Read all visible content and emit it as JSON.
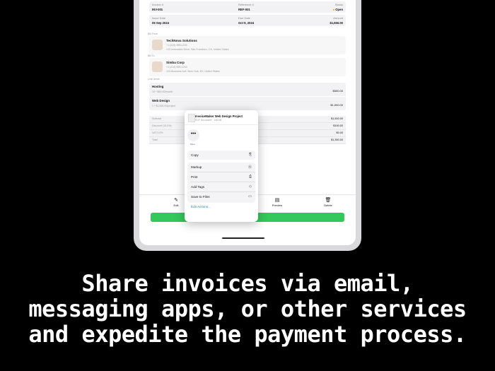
{
  "header": {
    "invoice_label": "Invoice #",
    "invoice_value": "INV-001",
    "reference_label": "Reference #",
    "reference_value": "REF-001",
    "status_label": "Status",
    "status_value": "Open",
    "issue_label": "Issue Date",
    "issue_value": "09 Sep 2024",
    "due_label": "Due Date",
    "due_value": "Oct 9, 2024",
    "amount_label": "Amount",
    "amount_value": "$1,550.00"
  },
  "bill_from": {
    "label": "Bill From",
    "name": "TechNova Solutions",
    "phone": "+1 (415) 555-1234",
    "address": "123 Innovation Drive, San Francisco, CA, United States"
  },
  "bill_to": {
    "label": "Bill To",
    "name": "Simba Corp",
    "phone": "+1 (212) 555-1234",
    "address": "123 Business Ave, New York, NY, United States"
  },
  "line_items": {
    "label": "Line Items",
    "items": [
      {
        "name": "Hosting",
        "detail": "10 * $50.00/month",
        "amount": "$500.00"
      },
      {
        "name": "Web Design",
        "detail": "1 * $1,000.00/project",
        "amount": "$1,000.00"
      }
    ]
  },
  "totals": [
    {
      "label": "Subtotal",
      "value": "$1,500.00"
    },
    {
      "label": "Discount (10.0%)",
      "value": "$150.00"
    },
    {
      "label": "VAT 0.0%",
      "value": "$0.00"
    },
    {
      "label": "Total",
      "value": "$1,350.00"
    }
  ],
  "toolbar": {
    "edit": "Edit",
    "preview": "Preview",
    "delete": "Delete"
  },
  "mark_paid": "Mark as paid",
  "share_sheet": {
    "title": "InvoiceMaker Web Design Project",
    "subtitle": "PDF Document · 148 KB",
    "more_label": "More",
    "actions": [
      "Copy",
      "Markup",
      "Print",
      "Add Tags",
      "Save to Files"
    ],
    "edit_actions": "Edit Actions..."
  },
  "caption": {
    "line1": "Share invoices via email,",
    "line2": "messaging apps, or other services",
    "line3": "and expedite the payment process."
  },
  "colors": {
    "accent_green": "#34c759",
    "link_blue": "#2a7be4",
    "status_orange": "#f39c12"
  }
}
